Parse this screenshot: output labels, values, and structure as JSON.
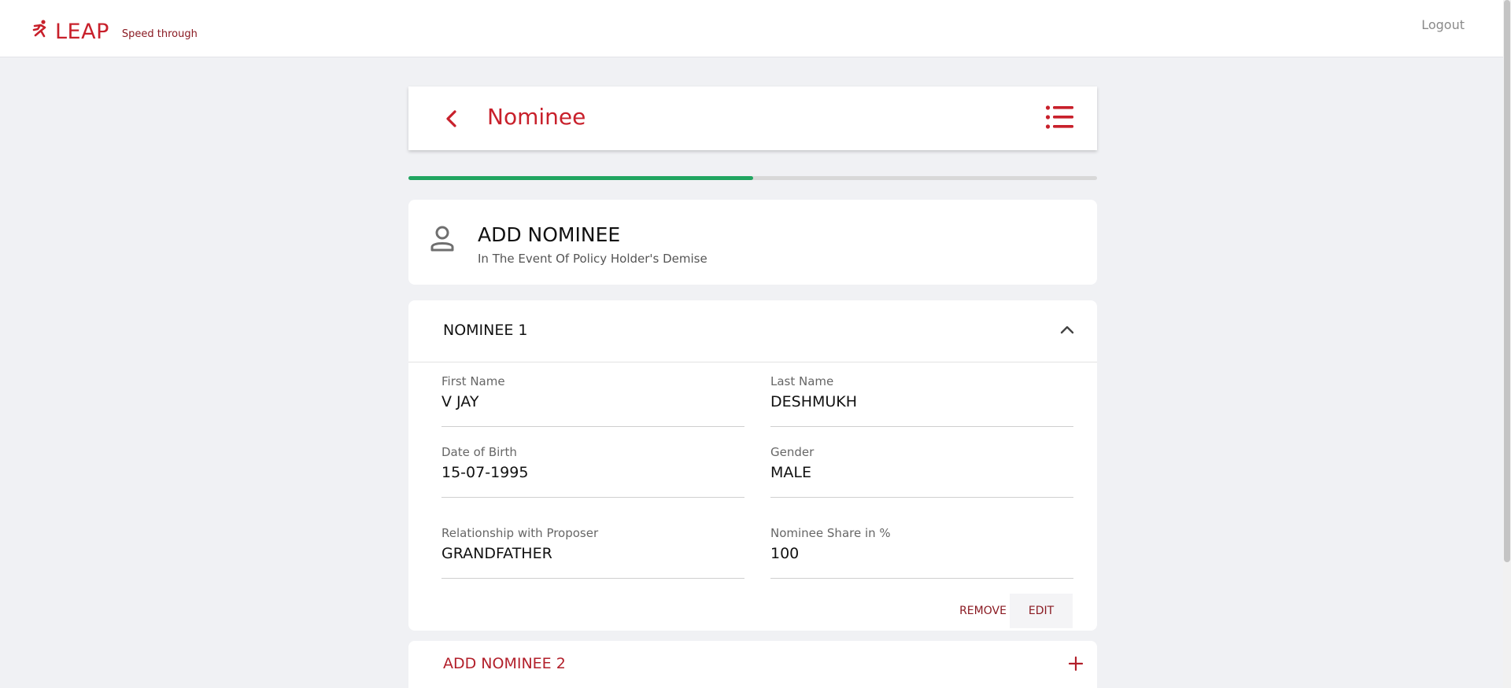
{
  "app": {
    "brand": "LEAP",
    "tagline": "Speed through",
    "logout": "Logout",
    "accent": "#c8202b",
    "icons": [
      "runner-logo-icon",
      "chevron-left-icon",
      "list-menu-icon",
      "person-icon",
      "chevron-up-icon",
      "plus-icon"
    ]
  },
  "header": {
    "title": "Nominee"
  },
  "progress": {
    "fraction": 0.5,
    "color": "#20a560"
  },
  "intro": {
    "title": "ADD NOMINEE",
    "subtitle": "In The Event Of Policy Holder's Demise"
  },
  "nominee1": {
    "title": "NOMINEE 1",
    "fields": [
      {
        "label": "First Name",
        "value": "V JAY"
      },
      {
        "label": "Last Name",
        "value": "DESHMUKH"
      },
      {
        "label": "Date of Birth",
        "value": "15-07-1995"
      },
      {
        "label": "Gender",
        "value": "MALE"
      },
      {
        "label": "Relationship with Proposer",
        "value": "GRANDFATHER"
      },
      {
        "label": "Nominee Share in %",
        "value": "100"
      }
    ],
    "remove_label": "REMOVE",
    "edit_label": "EDIT"
  },
  "add_nominee": {
    "label": "ADD NOMINEE 2"
  }
}
